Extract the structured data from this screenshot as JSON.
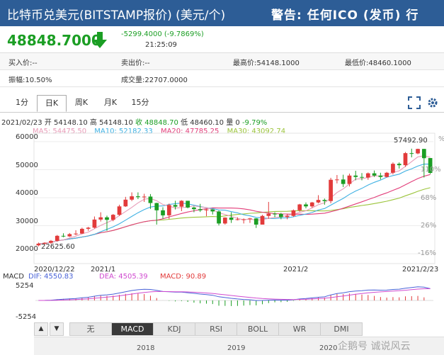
{
  "header": {
    "title": "比特币兑美元(BITSTAMP报价) (美元/个)",
    "notice": "警告: 任何ICO (发币) 行"
  },
  "quote": {
    "price": "48848.7000",
    "change": "-5299.4000 (-9.7869%)",
    "time": "21:25:09"
  },
  "stats": {
    "buy": "买入价:--",
    "sell": "卖出价:--",
    "high": "最高价:54148.1000",
    "low": "最低价:48460.1000",
    "amplitude": "振幅:10.50%",
    "volume": "成交量:22707.0000"
  },
  "period_tabs": [
    "1分",
    "日K",
    "周K",
    "月K",
    "15分"
  ],
  "active_period": "日K",
  "ohlc": {
    "date": "2021/02/23",
    "open": "开 54148.10",
    "high": "高 54148.10",
    "close": "收 48848.70",
    "low": "低 48460.10",
    "volume": "量 0",
    "pct": "-9.79%"
  },
  "ma": {
    "ma5": "MA5: 54475.50",
    "ma10": "MA10: 52182.33",
    "ma20": "MA20: 47785.25",
    "ma30": "MA30: 43092.74"
  },
  "colors": {
    "header": "#2d5d96",
    "up": "#e23b3b",
    "down": "#1b9e24",
    "ma5": "#e89bb7",
    "ma10": "#3fb1e3",
    "ma20": "#e23e7a",
    "ma30": "#9bc43a"
  },
  "chart_data": {
    "type": "candlestick",
    "y_ticks": [
      "60000",
      "50000",
      "40000",
      "30000",
      "20000"
    ],
    "pct_ticks": [
      "110%",
      "68%",
      "26%",
      "-16%"
    ],
    "pct_partial": "%",
    "x_labels": [
      "2020/12/22",
      "2021/1",
      "2021/2",
      "2021/2/23"
    ],
    "max_label": "57492.90",
    "min_label": "22625.60",
    "candles": [
      {
        "o": 23000,
        "c": 23600,
        "h": 24000,
        "l": 22625.6
      },
      {
        "o": 23600,
        "c": 23900,
        "h": 24100,
        "l": 23200
      },
      {
        "o": 23900,
        "c": 24600,
        "h": 24900,
        "l": 23500
      },
      {
        "o": 24600,
        "c": 26400,
        "h": 26700,
        "l": 24300
      },
      {
        "o": 26400,
        "c": 26200,
        "h": 27300,
        "l": 25900
      },
      {
        "o": 26200,
        "c": 27000,
        "h": 27400,
        "l": 26000
      },
      {
        "o": 27000,
        "c": 27200,
        "h": 28400,
        "l": 26600
      },
      {
        "o": 27200,
        "c": 28900,
        "h": 29300,
        "l": 27000
      },
      {
        "o": 28900,
        "c": 29300,
        "h": 29600,
        "l": 28200
      },
      {
        "o": 29300,
        "c": 32200,
        "h": 33300,
        "l": 29000
      },
      {
        "o": 32200,
        "c": 33000,
        "h": 34800,
        "l": 31500
      },
      {
        "o": 33000,
        "c": 32100,
        "h": 33600,
        "l": 28200
      },
      {
        "o": 32100,
        "c": 33900,
        "h": 34200,
        "l": 31600
      },
      {
        "o": 33900,
        "c": 36900,
        "h": 37500,
        "l": 33500
      },
      {
        "o": 36900,
        "c": 39300,
        "h": 40300,
        "l": 36700
      },
      {
        "o": 39300,
        "c": 40500,
        "h": 41900,
        "l": 38800
      },
      {
        "o": 40500,
        "c": 40200,
        "h": 41900,
        "l": 39500
      },
      {
        "o": 40200,
        "c": 40400,
        "h": 41400,
        "l": 38500
      },
      {
        "o": 40400,
        "c": 38100,
        "h": 41300,
        "l": 36000
      },
      {
        "o": 38100,
        "c": 35500,
        "h": 38200,
        "l": 30400
      },
      {
        "o": 35500,
        "c": 33700,
        "h": 36600,
        "l": 32500
      },
      {
        "o": 33700,
        "c": 37400,
        "h": 37900,
        "l": 32400
      },
      {
        "o": 37400,
        "c": 36800,
        "h": 38900,
        "l": 35800
      },
      {
        "o": 36800,
        "c": 38900,
        "h": 39100,
        "l": 35200
      },
      {
        "o": 38900,
        "c": 36500,
        "h": 38200,
        "l": 36200
      },
      {
        "o": 36500,
        "c": 35900,
        "h": 36900,
        "l": 34800
      },
      {
        "o": 35900,
        "c": 35500,
        "h": 37800,
        "l": 34900
      },
      {
        "o": 35500,
        "c": 35800,
        "h": 36100,
        "l": 33400
      },
      {
        "o": 35800,
        "c": 35100,
        "h": 35900,
        "l": 34000
      },
      {
        "o": 35100,
        "c": 30800,
        "h": 35400,
        "l": 30100
      },
      {
        "o": 30800,
        "c": 32900,
        "h": 33000,
        "l": 30400
      },
      {
        "o": 32900,
        "c": 32100,
        "h": 34800,
        "l": 31000
      },
      {
        "o": 32100,
        "c": 32300,
        "h": 33000,
        "l": 31900
      },
      {
        "o": 32300,
        "c": 32300,
        "h": 32600,
        "l": 30800
      },
      {
        "o": 32300,
        "c": 32600,
        "h": 32800,
        "l": 31000
      },
      {
        "o": 32600,
        "c": 30400,
        "h": 32700,
        "l": 29200
      },
      {
        "o": 30400,
        "c": 33500,
        "h": 33900,
        "l": 30800
      },
      {
        "o": 33500,
        "c": 34300,
        "h": 38500,
        "l": 32500
      },
      {
        "o": 34300,
        "c": 34200,
        "h": 34800,
        "l": 33000
      },
      {
        "o": 34200,
        "c": 33100,
        "h": 34600,
        "l": 32300
      },
      {
        "o": 33100,
        "c": 33500,
        "h": 34200,
        "l": 32300
      },
      {
        "o": 33500,
        "c": 35500,
        "h": 35800,
        "l": 33200
      },
      {
        "o": 35500,
        "c": 37600,
        "h": 37800,
        "l": 35000
      },
      {
        "o": 37600,
        "c": 36900,
        "h": 38300,
        "l": 36200
      },
      {
        "o": 36900,
        "c": 38300,
        "h": 38500,
        "l": 36400
      },
      {
        "o": 38300,
        "c": 39200,
        "h": 40900,
        "l": 38000
      },
      {
        "o": 39200,
        "c": 38800,
        "h": 39700,
        "l": 37500
      },
      {
        "o": 38800,
        "c": 46400,
        "h": 47100,
        "l": 38000
      },
      {
        "o": 46400,
        "c": 46500,
        "h": 48100,
        "l": 45100
      },
      {
        "o": 46500,
        "c": 44900,
        "h": 48200,
        "l": 43800
      },
      {
        "o": 44900,
        "c": 47900,
        "h": 48600,
        "l": 44000
      },
      {
        "o": 47900,
        "c": 47400,
        "h": 49600,
        "l": 46200
      },
      {
        "o": 47400,
        "c": 47200,
        "h": 48800,
        "l": 46200
      },
      {
        "o": 47200,
        "c": 48700,
        "h": 49000,
        "l": 46400
      },
      {
        "o": 48700,
        "c": 47900,
        "h": 49700,
        "l": 47400
      },
      {
        "o": 47900,
        "c": 47400,
        "h": 48900,
        "l": 46500
      },
      {
        "o": 47400,
        "c": 48900,
        "h": 49200,
        "l": 47200
      },
      {
        "o": 48900,
        "c": 52100,
        "h": 52600,
        "l": 48300
      },
      {
        "o": 52100,
        "c": 51600,
        "h": 52600,
        "l": 50400
      },
      {
        "o": 51600,
        "c": 55900,
        "h": 56300,
        "l": 51000
      },
      {
        "o": 55900,
        "c": 55800,
        "h": 57492.9,
        "l": 54400
      },
      {
        "o": 55800,
        "c": 57400,
        "h": 57492.9,
        "l": 55500
      },
      {
        "o": 57400,
        "c": 54100,
        "h": 57450,
        "l": 47200
      },
      {
        "o": 54148.1,
        "c": 48848.7,
        "h": 54148.1,
        "l": 48460.1
      }
    ],
    "macd": {
      "dif": "DIF: 4550.83",
      "dea": "DEA: 4505.39",
      "macd": "MACD: 90.89",
      "y_top": "5254",
      "y_bottom": "-5254"
    }
  },
  "indicator_tabs": [
    "无",
    "MACD",
    "KDJ",
    "RSI",
    "BOLL",
    "WR",
    "DMI"
  ],
  "active_indicator": "MACD",
  "timeline_years": [
    "2018",
    "2019",
    "2020"
  ],
  "watermark": "企鹅号 诚说风云"
}
